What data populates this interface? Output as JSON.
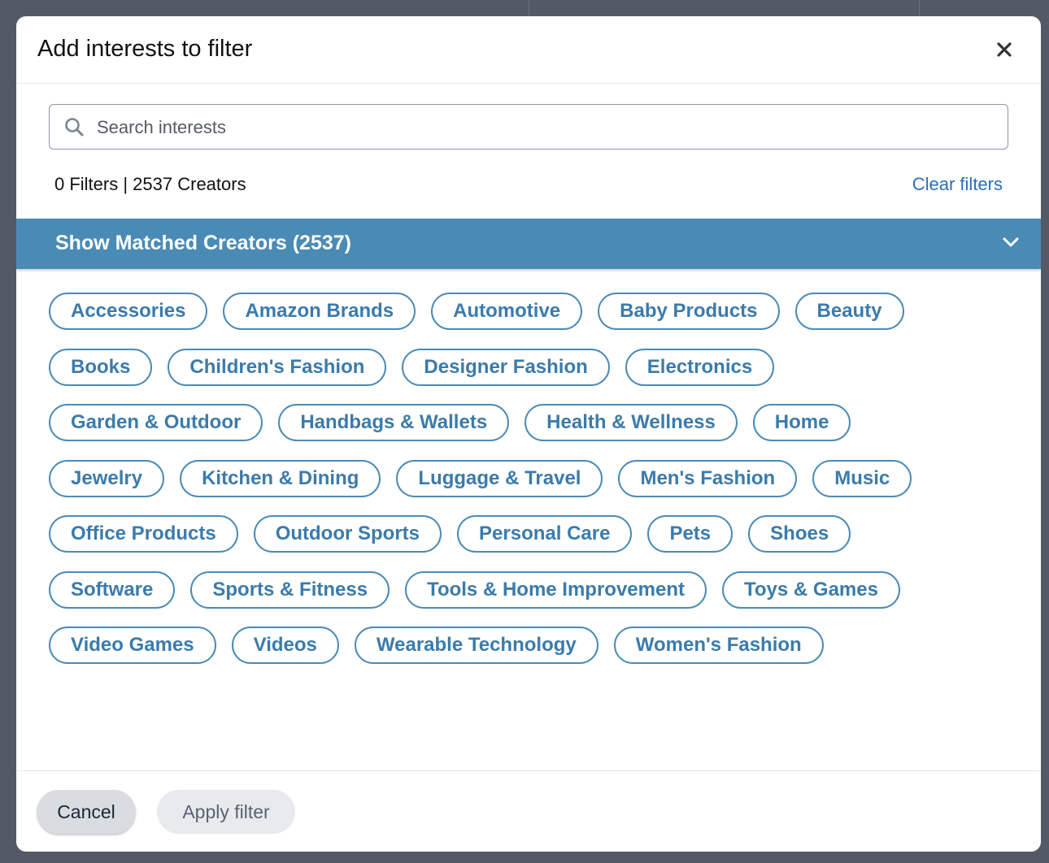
{
  "modal": {
    "title": "Add interests to filter",
    "close_icon": "close-icon"
  },
  "search": {
    "placeholder": "Search interests",
    "value": "",
    "icon": "search-icon"
  },
  "summary": {
    "count_text": "0 Filters | 2537 Creators",
    "clear_label": "Clear filters"
  },
  "matched_bar": {
    "label": "Show Matched Creators (2537)",
    "icon": "chevron-down-icon"
  },
  "interest_rows": [
    [
      "Accessories",
      "Amazon Brands",
      "Automotive",
      "Baby Products",
      "Beauty"
    ],
    [
      "Books",
      "Children's Fashion",
      "Designer Fashion",
      "Electronics"
    ],
    [
      "Garden & Outdoor",
      "Handbags & Wallets",
      "Health & Wellness",
      "Home"
    ],
    [
      "Jewelry",
      "Kitchen & Dining",
      "Luggage & Travel",
      "Men's Fashion",
      "Music"
    ],
    [
      "Office Products",
      "Outdoor Sports",
      "Personal Care",
      "Pets",
      "Shoes"
    ],
    [
      "Software",
      "Sports & Fitness",
      "Tools & Home Improvement",
      "Toys & Games"
    ],
    [
      "Video Games",
      "Videos",
      "Wearable Technology",
      "Women's Fashion"
    ]
  ],
  "footer": {
    "cancel_label": "Cancel",
    "apply_label": "Apply filter"
  },
  "colors": {
    "accent": "#4a8bb6",
    "link": "#2a6ebb",
    "overlay": "#535966"
  }
}
